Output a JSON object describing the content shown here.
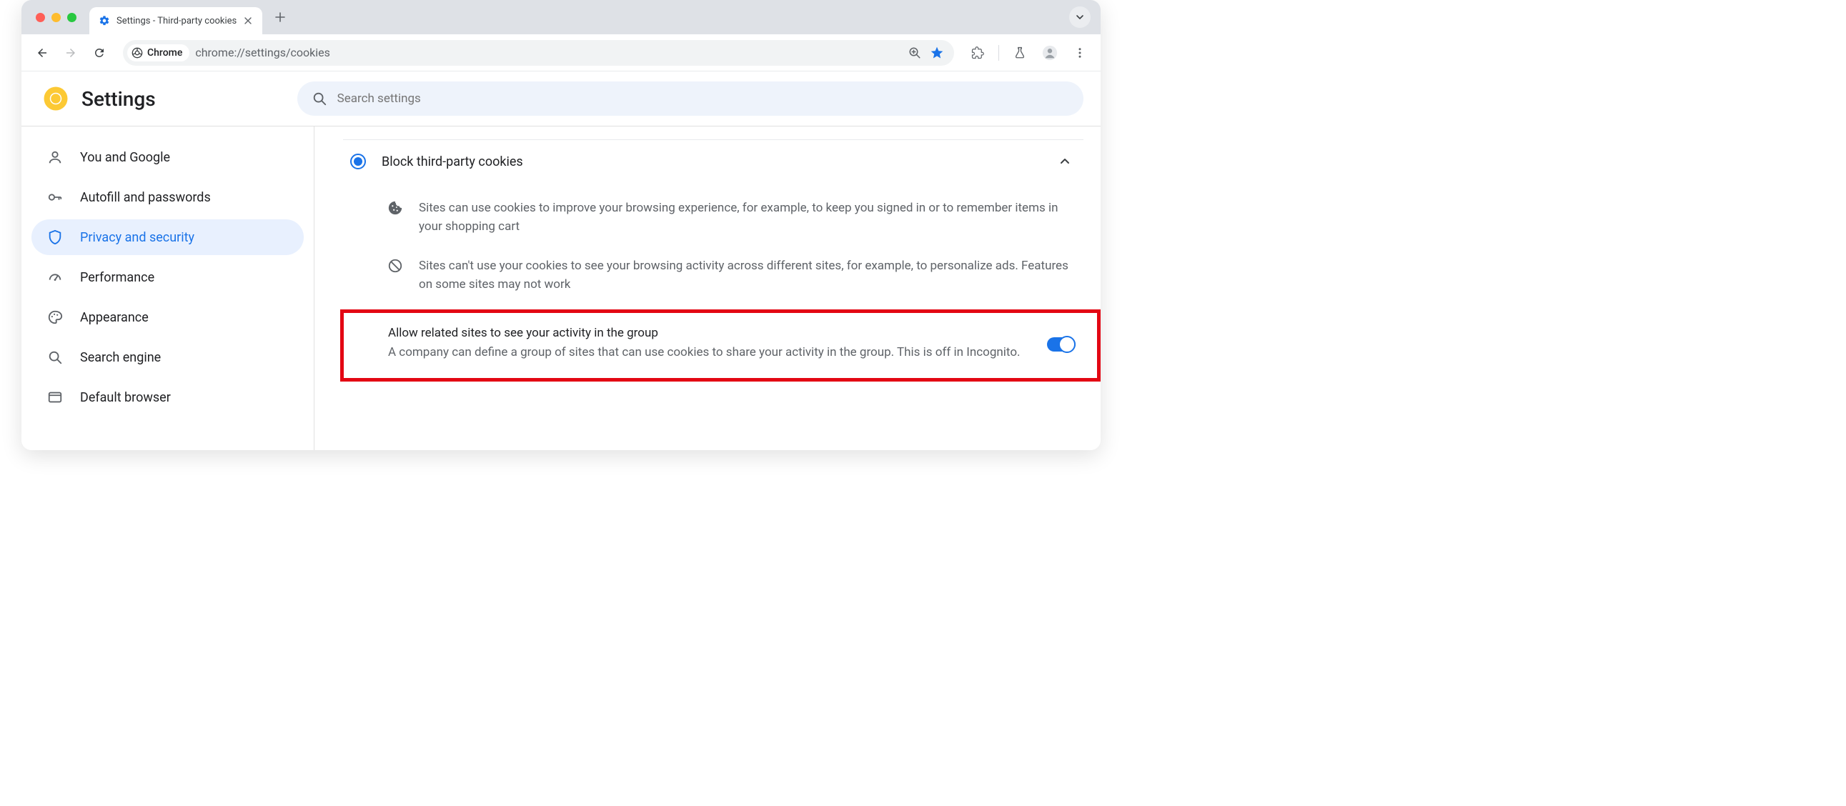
{
  "window": {
    "tab_title": "Settings - Third-party cookies"
  },
  "toolbar": {
    "chrome_chip": "Chrome",
    "url": "chrome://settings/cookies"
  },
  "header": {
    "title": "Settings",
    "search_placeholder": "Search settings"
  },
  "sidebar": {
    "items": [
      {
        "label": "You and Google"
      },
      {
        "label": "Autofill and passwords"
      },
      {
        "label": "Privacy and security"
      },
      {
        "label": "Performance"
      },
      {
        "label": "Appearance"
      },
      {
        "label": "Search engine"
      },
      {
        "label": "Default browser"
      }
    ]
  },
  "main": {
    "option_title": "Block third-party cookies",
    "detail_allowed": "Sites can use cookies to improve your browsing experience, for example, to keep you signed in or to remember items in your shopping cart",
    "detail_blocked": "Sites can't use your cookies to see your browsing activity across different sites, for example, to personalize ads. Features on some sites may not work",
    "toggle_title": "Allow related sites to see your activity in the group",
    "toggle_desc": "A company can define a group of sites that can use cookies to share your activity in the group. This is off in Incognito."
  }
}
